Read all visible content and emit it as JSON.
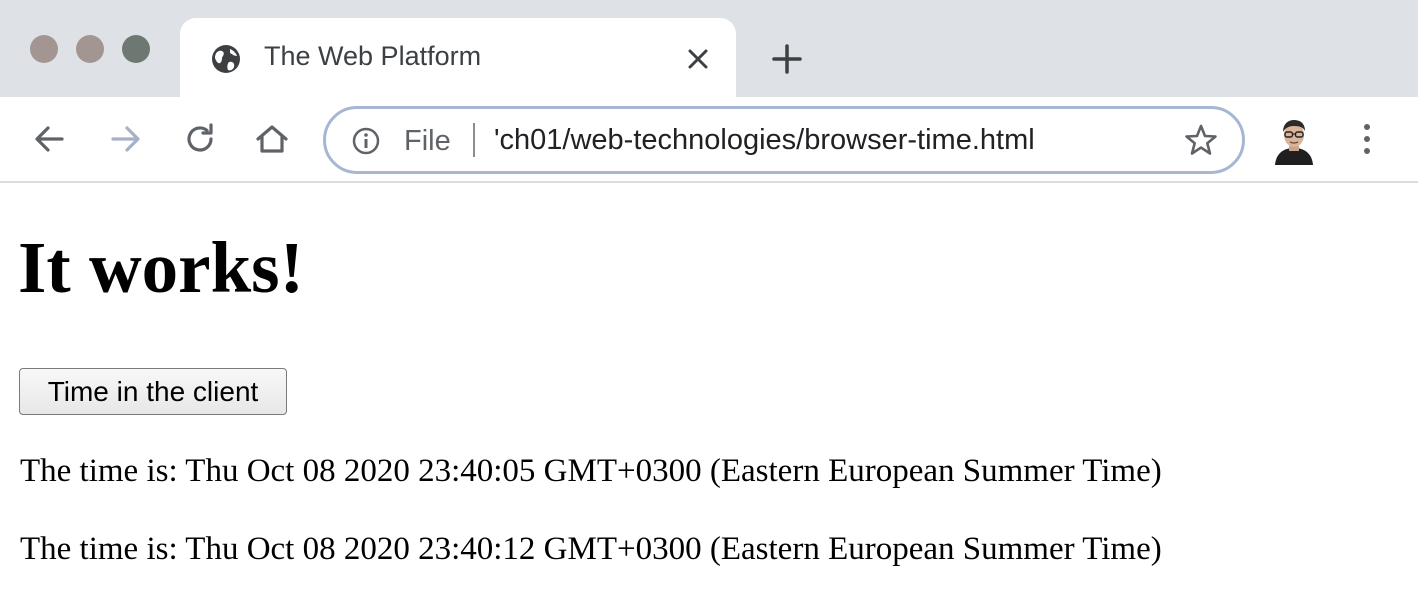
{
  "browser": {
    "tab_title": "The Web Platform",
    "omnibox": {
      "scheme_label": "File",
      "url": "'ch01/web-technologies/browser-time.html"
    },
    "icons": {
      "favicon": "globe-icon",
      "tab_close": "close-icon",
      "new_tab": "plus-icon",
      "back": "arrow-left-icon",
      "forward": "arrow-right-icon",
      "reload": "reload-icon",
      "home": "home-icon",
      "site_info": "info-icon",
      "bookmark": "star-icon",
      "profile": "avatar",
      "menu": "kebab-menu-icon"
    },
    "colors": {
      "tab_strip": "#dee1e6",
      "omnibox_border": "#a6b7d4"
    }
  },
  "page": {
    "heading": "It works!",
    "button_label": "Time in the client",
    "time_lines": [
      "The time is: Thu Oct 08 2020 23:40:05 GMT+0300 (Eastern European Summer Time)",
      "The time is: Thu Oct 08 2020 23:40:12 GMT+0300 (Eastern European Summer Time)"
    ]
  }
}
